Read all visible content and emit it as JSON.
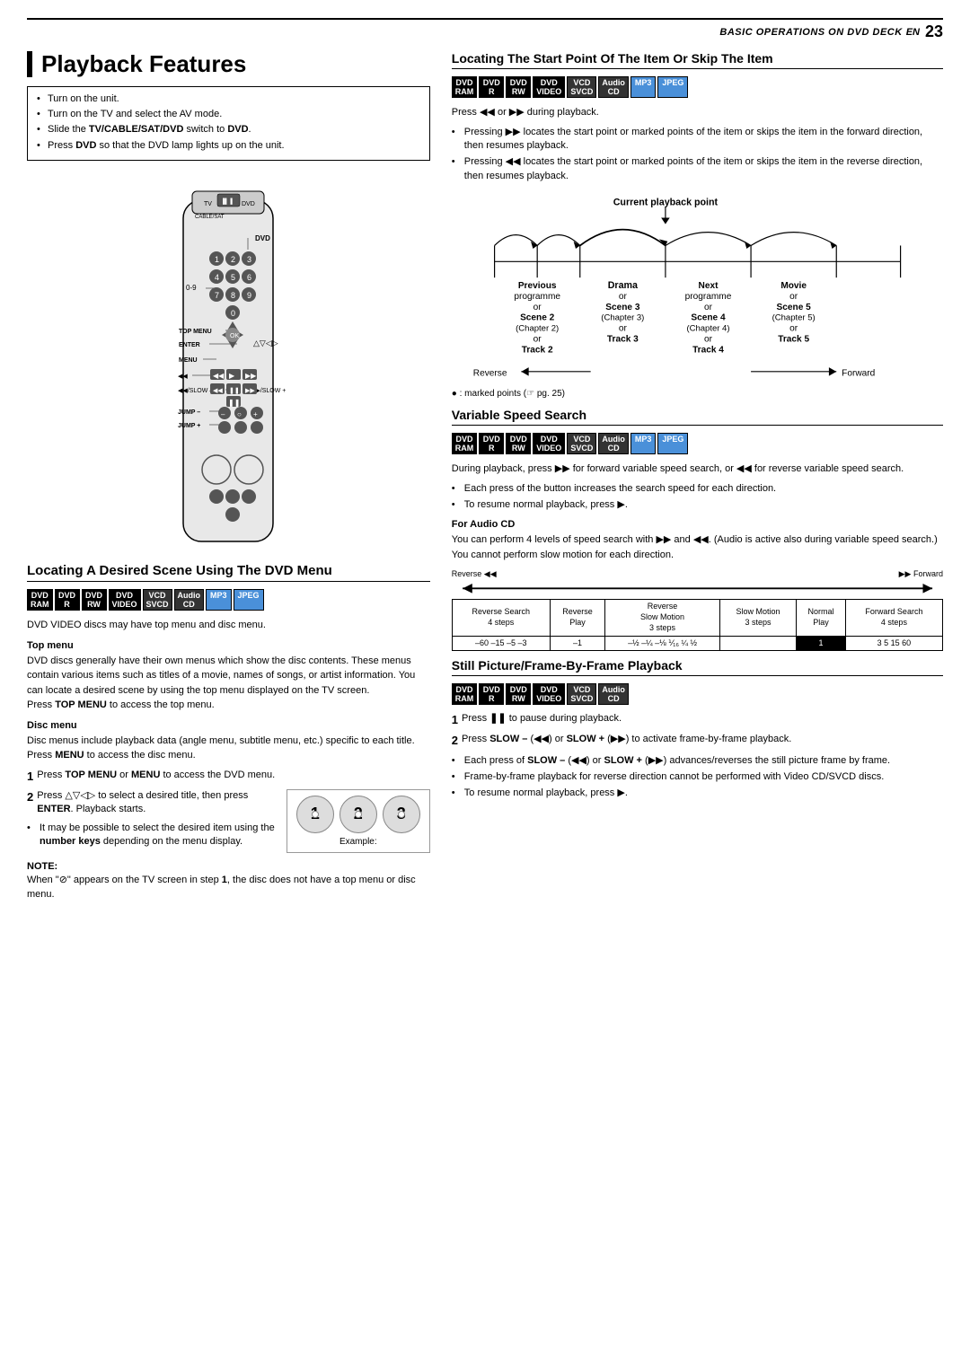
{
  "header": {
    "title": "BASIC OPERATIONS ON DVD DECK",
    "lang": "EN",
    "page": "23"
  },
  "page_title": "Playback Features",
  "bullet_intro": [
    "Turn on the unit.",
    "Turn on the TV and select the AV mode.",
    "Slide the TV/CABLE/SAT/DVD switch to DVD.",
    "Press DVD so that the DVD lamp lights up on the unit."
  ],
  "section_dvd_menu": {
    "title": "Locating A Desired Scene Using The DVD Menu",
    "badges": [
      "DVD RAM",
      "DVD R",
      "DVD RW",
      "DVD VIDEO",
      "VCD SVCD",
      "Audio CD",
      "MP3",
      "JPEG"
    ],
    "intro": "DVD VIDEO discs may have top menu and disc menu.",
    "top_menu_heading": "Top menu",
    "top_menu_text": "DVD discs generally have their own menus which show the disc contents. These menus contain various items such as titles of a movie, names of songs, or artist information. You can locate a desired scene by using the top menu displayed on the TV screen. Press TOP MENU to access the top menu.",
    "disc_menu_heading": "Disc menu",
    "disc_menu_text": "Disc menus include playback data (angle menu, subtitle menu, etc.) specific to each title.\nPress MENU to access the disc menu.",
    "steps": [
      "Press TOP MENU or MENU to access the DVD menu.",
      "Press △▽◁▷ to select a desired title, then press ENTER. Playback starts.",
      "It may be possible to select the desired item using the number keys depending on the menu display."
    ],
    "note_heading": "NOTE:",
    "note_text": "When \"⊘\" appears on the TV screen in step 1, the disc does not have a top menu or disc menu.",
    "example_label": "Example:"
  },
  "section_start_point": {
    "title": "Locating The Start Point Of The Item Or Skip The Item",
    "badges": [
      "DVD RAM",
      "DVD R",
      "DVD RW",
      "DVD VIDEO",
      "VCD SVCD",
      "Audio CD",
      "MP3",
      "JPEG"
    ],
    "intro": "Press ◀◀ or ▶▶ during playback.",
    "bullets": [
      "Pressing ▶▶ locates the start point or marked points of the item or skips the item in the forward direction, then resumes playback.",
      "Pressing ◀◀ locates the start point or marked points of the item or skips the item in the reverse direction, then resumes playback."
    ],
    "diagram": {
      "label_current": "Current playback point",
      "columns": [
        {
          "label": "Previous\nprogramme\nor\nScene 2\n(Chapter 2)\nor\nTrack 2"
        },
        {
          "label": "Drama\nor\nScene 3\n(Chapter 3)\nor\nTrack 3",
          "bold": true
        },
        {
          "label": "Next\nprogramme\nor\nScene 4\n(Chapter 4)\nor\nTrack 4"
        },
        {
          "label": "Movie\nor\nScene 5\n(Chapter 5)\nor\nTrack 5"
        }
      ],
      "reverse_label": "Reverse",
      "forward_label": "Forward",
      "marked_note": "● : marked points (☞ pg. 25)"
    }
  },
  "section_variable_speed": {
    "title": "Variable Speed Search",
    "badges": [
      "DVD RAM",
      "DVD R",
      "DVD RW",
      "DVD VIDEO",
      "VCD SVCD",
      "Audio CD",
      "MP3",
      "JPEG"
    ],
    "intro": "During playback, press ▶▶ for forward variable speed search, or ◀◀ for reverse variable speed search.",
    "bullets": [
      "Each press of the button increases the search speed for each direction.",
      "To resume normal playback, press ▶."
    ],
    "audio_cd_heading": "For Audio CD",
    "audio_cd_text": "You can perform 4 levels of speed search with ▶▶ and ◀◀. (Audio is active also during variable speed search.) You cannot perform slow motion for each direction.",
    "speed_diagram": {
      "reverse_label": "Reverse ◀◀",
      "forward_label": "▶▶ Forward",
      "rows": [
        [
          "Reverse Search\n4 steps",
          "Reverse\nPlay",
          "Reverse\nSlow Motion\n3 steps",
          "Slow Motion\n3 steps",
          "Normal\nPlay",
          "Forward Search\n4 steps"
        ],
        [
          "-60 -15 -5 -3",
          "-1",
          "-½ -¼ -⅛ ⅟₁₆ ¼ ½",
          "1",
          "3 5 15 60"
        ]
      ]
    }
  },
  "section_still_picture": {
    "title": "Still Picture/Frame-By-Frame Playback",
    "badges": [
      "DVD RAM",
      "DVD R",
      "DVD RW",
      "DVD VIDEO",
      "VCD SVCD",
      "Audio CD"
    ],
    "steps": [
      "Press ❚❚ to pause during playback.",
      "Press SLOW – (◀◀) or SLOW + (▶▶) to activate frame-by-frame playback."
    ],
    "bullets": [
      "Each press of SLOW – (◀◀) or SLOW + (▶▶) advances/reverses the still picture frame by frame.",
      "Frame-by-frame playback for reverse direction cannot be performed with Video CD/SVCD discs.",
      "To resume normal playback, press ▶."
    ]
  }
}
